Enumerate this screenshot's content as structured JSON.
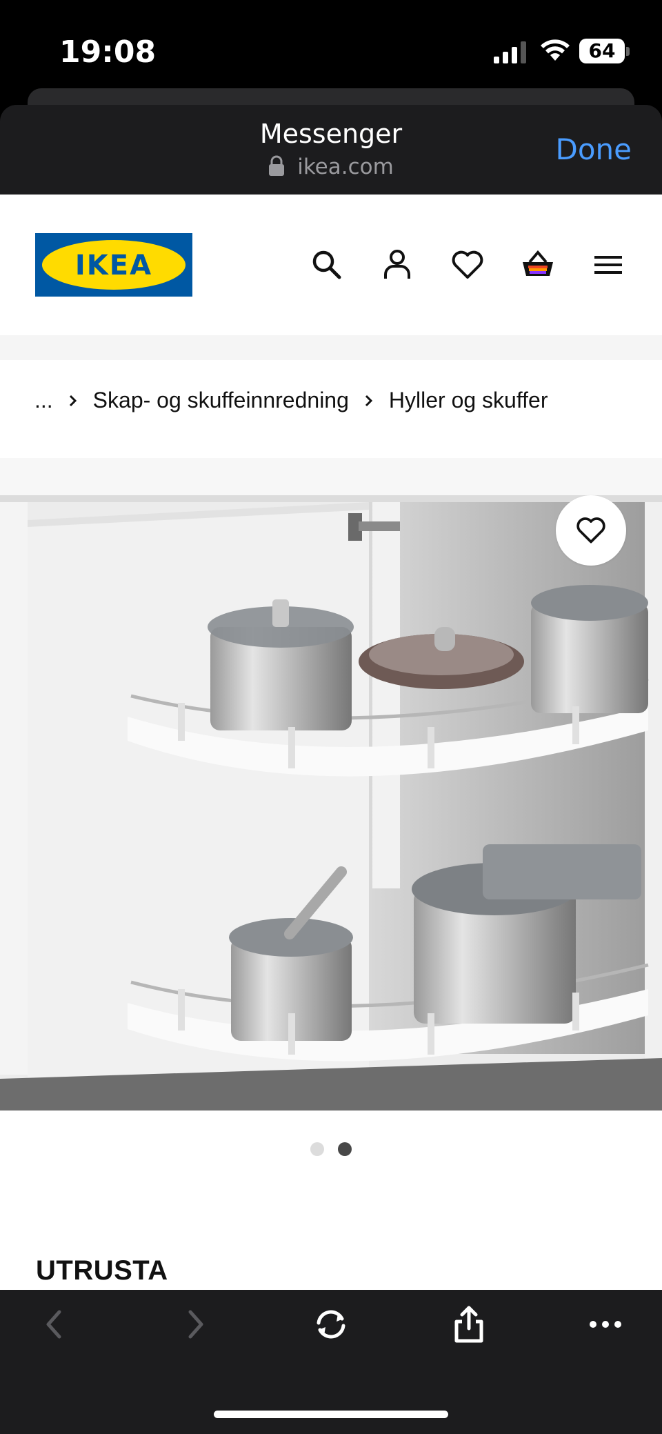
{
  "status_bar": {
    "time": "19:08",
    "battery": "64",
    "icons": [
      "signal-icon",
      "wifi-icon",
      "battery-icon"
    ]
  },
  "sheet": {
    "title": "Messenger",
    "url": "ikea.com",
    "done_label": "Done",
    "done_color": "#4a9cff"
  },
  "header": {
    "logo_text": "IKEA",
    "brand_colors": {
      "blue": "#0058a3",
      "yellow": "#ffdb00"
    },
    "icons": [
      "search-icon",
      "profile-icon",
      "heart-icon",
      "cart-icon",
      "menu-icon"
    ]
  },
  "breadcrumb": {
    "items": [
      "...",
      "Skap- og skuffeinnredning",
      "Hyller og skuffer"
    ]
  },
  "gallery": {
    "image_count": 2,
    "active_index": 1,
    "favorite_icon": "heart-icon"
  },
  "product": {
    "name": "UTRUSTA"
  },
  "toolbar": {
    "icons": [
      "back-icon",
      "forward-icon",
      "reload-icon",
      "share-icon",
      "more-icon"
    ]
  }
}
